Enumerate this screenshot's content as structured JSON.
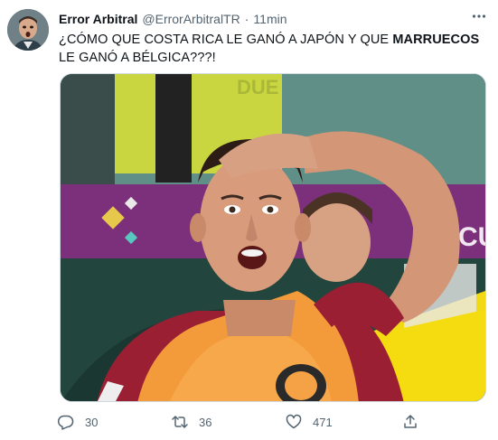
{
  "tweet": {
    "author_name": "Error Arbitral",
    "author_handle": "@ErrorArbitralTR",
    "separator": "·",
    "time": "11min",
    "text_part1": "¿CÓMO QUE COSTA RICA LE GANÓ A JAPÓN Y QUE ",
    "text_bold": "MARRUECOS",
    "text_part2": " LE GANÓ A BÉLGICA???!",
    "media_description_icon": "photo",
    "media_banner_text": "CU",
    "media_background_text": "DUE"
  },
  "actions": {
    "reply_count": "30",
    "retweet_count": "36",
    "like_count": "471"
  },
  "icons": {
    "more": "more-horizontal-icon",
    "reply": "reply-icon",
    "retweet": "retweet-icon",
    "like": "heart-icon",
    "share": "share-icon"
  },
  "colors": {
    "text_primary": "#0f1419",
    "text_secondary": "#536471",
    "border": "#cfd9de"
  }
}
